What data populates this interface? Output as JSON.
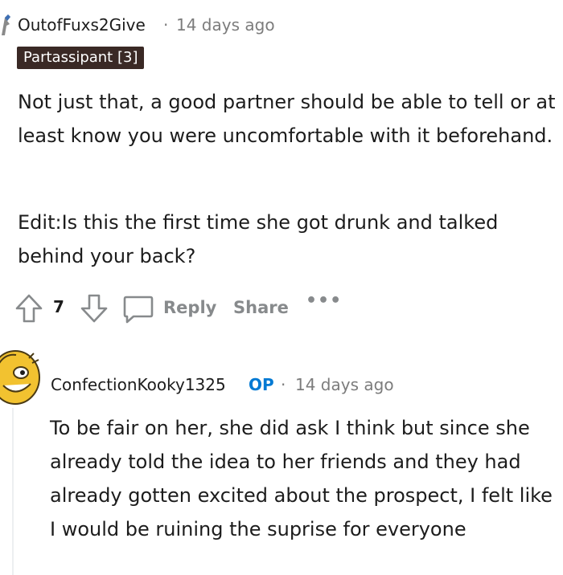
{
  "comments": [
    {
      "username": "OutofFuxs2Give",
      "separator": "·",
      "timestamp": "14 days ago",
      "flair": "Partassipant [3]",
      "paragraphs": [
        "Not just that, a good partner should be able to tell or at least know you were uncomfortable with it beforehand.",
        "Edit:Is this the first time she got drunk and talked behind your back?"
      ],
      "score": "7",
      "actions": {
        "reply": "Reply",
        "share": "Share",
        "more": "•••"
      }
    },
    {
      "username": "ConfectionKooky1325",
      "op_badge": "OP",
      "separator": "·",
      "timestamp": "14 days ago",
      "paragraphs": [
        "To be fair on her, she did ask I think but since she already told the idea to her friends and they had already gotten excited about the prospect, I felt like I would be ruining the suprise for everyone"
      ]
    }
  ],
  "colors": {
    "flair_bg": "#3a2925",
    "op_blue": "#0079d3",
    "muted": "#878a8c",
    "avatar_yellow": "#f2c230"
  },
  "icons": [
    "upvote-icon",
    "downvote-icon",
    "comment-icon",
    "more-options-icon",
    "avatar-icon"
  ]
}
